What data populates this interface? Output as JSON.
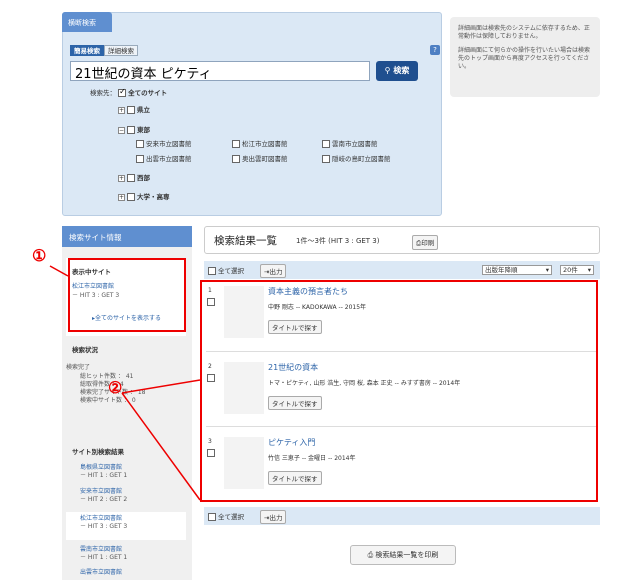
{
  "search_panel": {
    "tab": "横断検索",
    "mode_tabs": [
      "簡易検索",
      "詳細検索"
    ],
    "help": "?",
    "query": "21世紀の資本 ピケティ",
    "search_button": "検索",
    "targets_label": "検索先：",
    "all_sites": "全てのサイト",
    "groups": [
      {
        "label": "県立",
        "toggle": "+"
      },
      {
        "label": "東部",
        "toggle": "−",
        "sites": [
          "安来市立図書館",
          "松江市立図書館",
          "雲南市立図書館",
          "出雲市立図書館",
          "奥出雲町図書館",
          "隠岐の島町立図書館"
        ]
      },
      {
        "label": "西部",
        "toggle": "+"
      },
      {
        "label": "大学・高専",
        "toggle": "+"
      }
    ]
  },
  "notice": {
    "line1": "詳細画面は検索先のシステムに依存するため、正常動作は保障しておりません。",
    "line2": "詳細画面にて何らかの操作を行いたい場合は検索先のトップ画面から再度アクセスを行ってください。"
  },
  "sidebar": {
    "header": "検索サイト情報",
    "current_label": "表示中サイト",
    "current_site": "松江市立図書館",
    "current_hit": "－ HIT 3 : GET 3",
    "show_all": "全てのサイトを表示する",
    "status_label": "検索状況",
    "status_done": "検索完了",
    "status_lines": [
      "総ヒット件数 ： 41",
      "総取得件数 ： 4",
      "検索完了サイト数 ： 18",
      "検索中サイト数 ： 0"
    ],
    "per_site_label": "サイト別検索結果",
    "per_site": [
      {
        "name": "島根県立図書館",
        "hit": "－ HIT 1 : GET 1"
      },
      {
        "name": "安来市立図書館",
        "hit": "－ HIT 2 : GET 2"
      },
      {
        "name": "松江市立図書館",
        "hit": "－ HIT 3 : GET 3"
      },
      {
        "name": "雲南市立図書館",
        "hit": "－ HIT 1 : GET 1"
      },
      {
        "name": "出雲市立図書館",
        "hit": ""
      }
    ]
  },
  "results": {
    "title": "検索結果一覧",
    "count": "1件～3件 (HIT 3 : GET 3)",
    "print": "印刷",
    "select_all": "全て選択",
    "output": "出力",
    "sort": "出版年降順",
    "per_page": "20件",
    "items": [
      {
        "num": "1",
        "title": "資本主義の預言者たち",
        "meta": "中野 剛志 -- KADOKAWA -- 2015年",
        "button": "タイトルで探す"
      },
      {
        "num": "2",
        "title": "21世紀の資本",
        "meta": "トマ・ピケティ, 山形 浩生, 守岡 桜, 森本 正史 -- みすず書房 -- 2014年",
        "button": "タイトルで探す"
      },
      {
        "num": "3",
        "title": "ピケティ入門",
        "meta": "竹信 三恵子 -- 金曜日 -- 2014年",
        "button": "タイトルで探す"
      }
    ],
    "print_all": "検索結果一覧を印刷"
  },
  "annotations": {
    "marker1": "①",
    "marker2": "②"
  }
}
